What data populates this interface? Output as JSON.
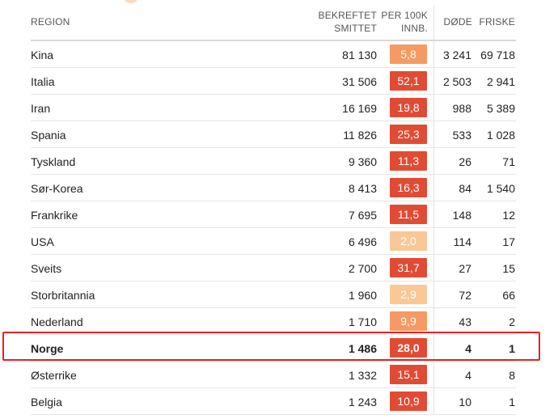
{
  "headers": {
    "region": "REGION",
    "confirmed_line1": "BEKREFTET",
    "confirmed_line2": "SMITTET",
    "per100k_line1": "PER 100K",
    "per100k_line2": "INNB.",
    "deaths": "DØDE",
    "recovered": "FRISKE"
  },
  "colors": {
    "highlight_border": "#e52222",
    "badge_pale": "#f9c896",
    "badge_light": "#f59a62",
    "badge_dark": "#e14b34"
  },
  "rows": [
    {
      "country": "Kina",
      "confirmed": "81 130",
      "per100k": "5,8",
      "deaths": "3 241",
      "recovered": "69 718",
      "badge_color": "#f59a62"
    },
    {
      "country": "Italia",
      "confirmed": "31 506",
      "per100k": "52,1",
      "deaths": "2 503",
      "recovered": "2 941",
      "badge_color": "#e14b34"
    },
    {
      "country": "Iran",
      "confirmed": "16 169",
      "per100k": "19,8",
      "deaths": "988",
      "recovered": "5 389",
      "badge_color": "#e14b34"
    },
    {
      "country": "Spania",
      "confirmed": "11 826",
      "per100k": "25,3",
      "deaths": "533",
      "recovered": "1 028",
      "badge_color": "#e14b34"
    },
    {
      "country": "Tyskland",
      "confirmed": "9 360",
      "per100k": "11,3",
      "deaths": "26",
      "recovered": "71",
      "badge_color": "#e14b34"
    },
    {
      "country": "Sør-Korea",
      "confirmed": "8 413",
      "per100k": "16,3",
      "deaths": "84",
      "recovered": "1 540",
      "badge_color": "#e14b34"
    },
    {
      "country": "Frankrike",
      "confirmed": "7 695",
      "per100k": "11,5",
      "deaths": "148",
      "recovered": "12",
      "badge_color": "#e14b34"
    },
    {
      "country": "USA",
      "confirmed": "6 496",
      "per100k": "2,0",
      "deaths": "114",
      "recovered": "17",
      "badge_color": "#f9c896"
    },
    {
      "country": "Sveits",
      "confirmed": "2 700",
      "per100k": "31,7",
      "deaths": "27",
      "recovered": "15",
      "badge_color": "#e14b34"
    },
    {
      "country": "Storbritannia",
      "confirmed": "1 960",
      "per100k": "2,9",
      "deaths": "72",
      "recovered": "66",
      "badge_color": "#f9c896"
    },
    {
      "country": "Nederland",
      "confirmed": "1 710",
      "per100k": "9,9",
      "deaths": "43",
      "recovered": "2",
      "badge_color": "#f59a62"
    },
    {
      "country": "Norge",
      "confirmed": "1 486",
      "per100k": "28,0",
      "deaths": "4",
      "recovered": "1",
      "badge_color": "#e14b34",
      "highlight": true
    },
    {
      "country": "Østerrike",
      "confirmed": "1 332",
      "per100k": "15,1",
      "deaths": "4",
      "recovered": "8",
      "badge_color": "#e14b34"
    },
    {
      "country": "Belgia",
      "confirmed": "1 243",
      "per100k": "10,9",
      "deaths": "10",
      "recovered": "1",
      "badge_color": "#e14b34"
    }
  ]
}
